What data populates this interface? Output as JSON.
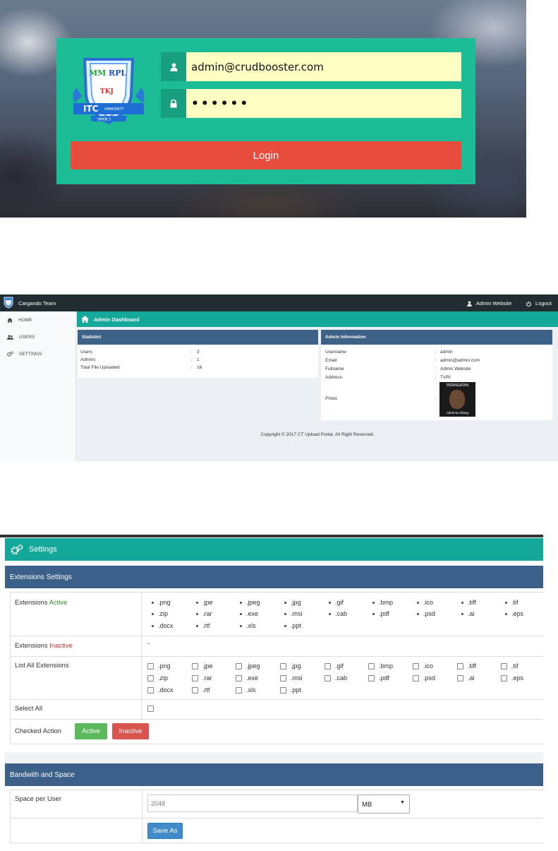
{
  "login": {
    "email_value": "admin@crudbooster.com",
    "password_value": "••••••",
    "login_label": "Login",
    "logo": {
      "top_left": "MM",
      "top_right": "RPL",
      "middle": "TKJ",
      "band": "ITC",
      "band_small": "OMMUNITY",
      "bottom": "SMKN 5"
    }
  },
  "dashboard": {
    "brand": "Cargando Team",
    "user_label": "Admin Website",
    "logout_label": "Logout",
    "sidebar": [
      {
        "label": "HOME",
        "icon": "home-icon"
      },
      {
        "label": "USERS",
        "icon": "users-icon"
      },
      {
        "label": "SETTINGS",
        "icon": "gears-icon"
      }
    ],
    "header_title": "Admin Dashboard",
    "statistic": {
      "title": "Statistict",
      "rows": [
        {
          "key": "Users",
          "value": "3"
        },
        {
          "key": "Admins",
          "value": "1"
        },
        {
          "key": "Total File Uploaded",
          "value": "16"
        }
      ]
    },
    "admin_info": {
      "title": "Admin Information",
      "rows": [
        {
          "key": "Username",
          "value": "admin"
        },
        {
          "key": "Email",
          "value": "admin@admin.com"
        },
        {
          "key": "Fullname",
          "value": "Admin Website"
        },
        {
          "key": "Address",
          "value": "TVRI"
        },
        {
          "key": "Photo",
          "value": ""
        }
      ],
      "photo_caption_top": "PERINGATAN",
      "photo_caption_bottom": "rokok-ku hilang"
    },
    "colon": ":",
    "footer": "Copyright © 2017 CT Upload Portal. All Right Reserved."
  },
  "settings": {
    "title": "Settings",
    "extensions_section": "Extensions Settings",
    "active_label_prefix": "Extensions ",
    "active_word": "Active",
    "inactive_word": "Inactive",
    "inactive_value": "-",
    "list_all_label": "List All Extensions",
    "select_all_label": "Select All",
    "checked_action_label": "Checked Action",
    "active_button": "Active",
    "inactive_button": "Inactive",
    "extensions": [
      ".png",
      ".jpe",
      ".jpeg",
      ".jpg",
      ".gif",
      ".bmp",
      ".ico",
      ".tiff",
      ".tif",
      ".zip",
      ".rar",
      ".exe",
      ".msi",
      ".cab",
      ".pdf",
      ".psd",
      ".ai",
      ".eps",
      ".docx",
      ".rtf",
      ".xls",
      ".ppt"
    ],
    "bandwidth_section": "Bandwith and Space",
    "space_label": "Space per User",
    "space_value": "2048",
    "unit_value": "MB",
    "save_button": "Save As",
    "colors": {
      "active_green": "#2e8b2e",
      "inactive_red": "#c9302c",
      "btn_green": "#5cb85c",
      "btn_red": "#d9534f",
      "btn_blue": "#428bca"
    }
  }
}
